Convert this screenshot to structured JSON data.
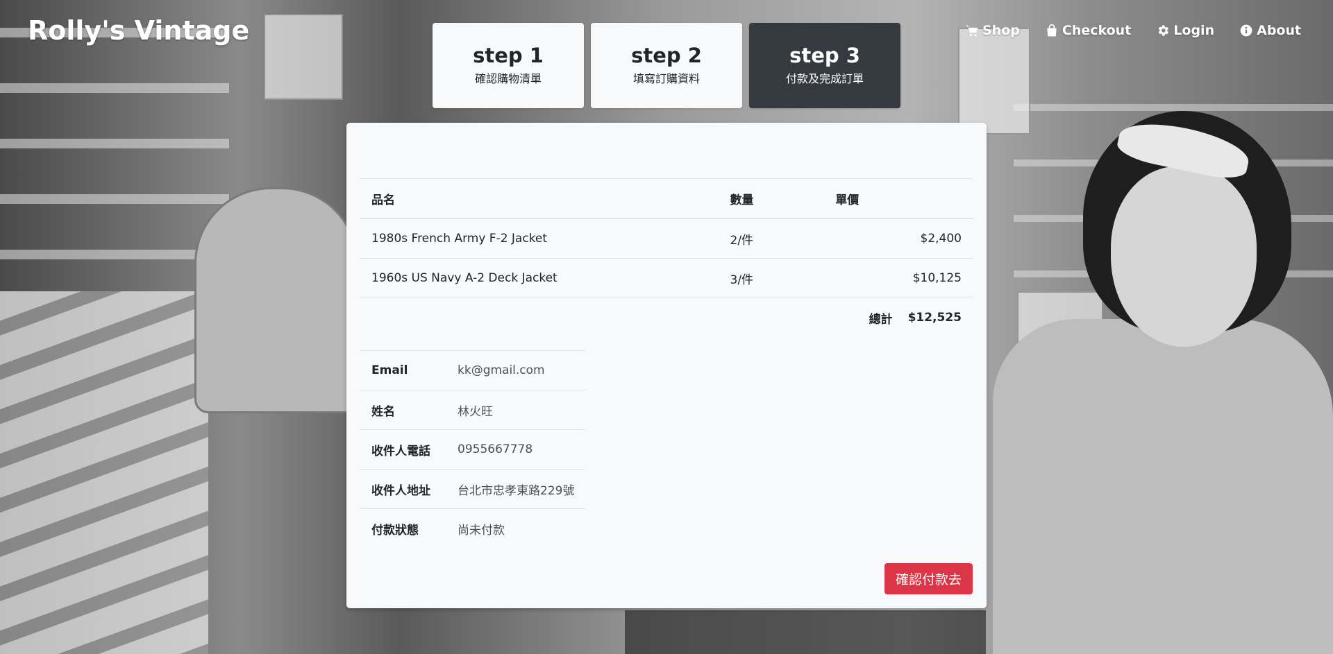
{
  "brand": "Rolly's Vintage",
  "nav": [
    {
      "label": "Shop",
      "icon": "cart-icon"
    },
    {
      "label": "Checkout",
      "icon": "bag-icon"
    },
    {
      "label": "Login",
      "icon": "gear-icon"
    },
    {
      "label": "About",
      "icon": "info-icon"
    }
  ],
  "steps": [
    {
      "title": "step 1",
      "subtitle": "確認購物清單",
      "active": false
    },
    {
      "title": "step 2",
      "subtitle": "填寫訂購資料",
      "active": false
    },
    {
      "title": "step 3",
      "subtitle": "付款及完成訂單",
      "active": true
    }
  ],
  "order": {
    "headers": {
      "name": "品名",
      "qty": "數量",
      "unit_price": "單價"
    },
    "items": [
      {
        "name": "1980s French Army F-2 Jacket",
        "qty": "2/件",
        "price": "$2,400"
      },
      {
        "name": "1960s US Navy A-2 Deck Jacket",
        "qty": "3/件",
        "price": "$10,125"
      }
    ],
    "total_label": "總計",
    "total": "$12,525"
  },
  "customer": [
    {
      "label": "Email",
      "value": "kk@gmail.com"
    },
    {
      "label": "姓名",
      "value": "林火旺"
    },
    {
      "label": "收件人電話",
      "value": "0955667778"
    },
    {
      "label": "收件人地址",
      "value": "台北市忠孝東路229號"
    },
    {
      "label": "付款狀態",
      "value": "尚未付款"
    }
  ],
  "pay_button": "確認付款去",
  "colors": {
    "accent_danger": "#dc3545",
    "active_step": "#343a40",
    "card_bg": "#f8f9fa"
  }
}
